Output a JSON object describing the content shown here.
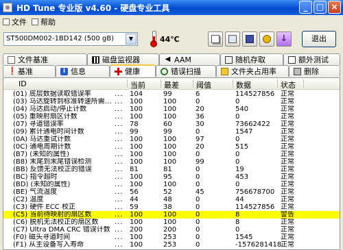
{
  "window": {
    "title": "HD Tune 专业版 v4.60 - 硬盘专业工具"
  },
  "menu": [
    {
      "label": "文件",
      "icon": "file-menu-icon"
    },
    {
      "label": "帮助",
      "icon": "help-menu-icon"
    }
  ],
  "toolbar": {
    "drive": "ST500DM002-1BD142 (500 gB)",
    "temperature": "44℃",
    "exit_label": "退出"
  },
  "tabs_top": [
    {
      "label": "文件基准",
      "icon": "file-benchmark-icon"
    },
    {
      "label": "磁盘监视器",
      "icon": "disk-monitor-icon"
    },
    {
      "label": "AAM",
      "icon": "speaker-icon"
    },
    {
      "label": "随机存取",
      "icon": "random-access-icon"
    },
    {
      "label": "额外测试",
      "icon": "extra-tests-icon"
    }
  ],
  "tabs_bottom": [
    {
      "label": "基准",
      "icon": "benchmark-icon"
    },
    {
      "label": "信息",
      "icon": "info-icon"
    },
    {
      "label": "健康",
      "icon": "health-cross-icon",
      "active": true
    },
    {
      "label": "错误扫描",
      "icon": "error-scan-icon"
    },
    {
      "label": "文件夹占用率",
      "icon": "folder-usage-icon"
    },
    {
      "label": "删除",
      "icon": "erase-icon"
    }
  ],
  "table": {
    "columns": [
      "ID",
      "当前",
      "最差",
      "阈值",
      "数据",
      "状态"
    ],
    "rows": [
      {
        "id": "(01) 底层数据读取错误率",
        "cur": "104",
        "worst": "99",
        "thr": "6",
        "data": "114527856",
        "status": "正常"
      },
      {
        "id": "(03) 马达旋转到标准转速所需…",
        "cur": "100",
        "worst": "100",
        "thr": "0",
        "data": "0",
        "status": "正常"
      },
      {
        "id": "(04) 马达启动/停止计数",
        "cur": "100",
        "worst": "100",
        "thr": "20",
        "data": "540",
        "status": "正常"
      },
      {
        "id": "(05) 重映射扇区计数",
        "cur": "100",
        "worst": "100",
        "thr": "36",
        "data": "0",
        "status": "正常"
      },
      {
        "id": "(07) 寻道错误率",
        "cur": "78",
        "worst": "60",
        "thr": "30",
        "data": "73662422",
        "status": "正常"
      },
      {
        "id": "(09) 累计通电时间计数",
        "cur": "99",
        "worst": "99",
        "thr": "0",
        "data": "1547",
        "status": "正常"
      },
      {
        "id": "(0A) 马达重试计数",
        "cur": "100",
        "worst": "100",
        "thr": "97",
        "data": "0",
        "status": "正常"
      },
      {
        "id": "(0C) 通电周期计数",
        "cur": "100",
        "worst": "100",
        "thr": "20",
        "data": "515",
        "status": "正常"
      },
      {
        "id": "(B7) (未知的属性)",
        "cur": "100",
        "worst": "100",
        "thr": "0",
        "data": "0",
        "status": "正常"
      },
      {
        "id": "(B8) 末尾到末尾错误检测",
        "cur": "100",
        "worst": "100",
        "thr": "99",
        "data": "0",
        "status": "正常"
      },
      {
        "id": "(BB) 反馈无法校正的错误",
        "cur": "81",
        "worst": "81",
        "thr": "0",
        "data": "19",
        "status": "正常"
      },
      {
        "id": "(BC) 指令超时",
        "cur": "100",
        "worst": "95",
        "thr": "0",
        "data": "453",
        "status": "正常"
      },
      {
        "id": "(BD) (未知的属性)",
        "cur": "100",
        "worst": "100",
        "thr": "0",
        "data": "0",
        "status": "正常"
      },
      {
        "id": "(BE) 气流温度",
        "cur": "56",
        "worst": "52",
        "thr": "45",
        "data": "756678700",
        "status": "正常"
      },
      {
        "id": "(C2) 温度",
        "cur": "44",
        "worst": "48",
        "thr": "0",
        "data": "44",
        "status": "正常"
      },
      {
        "id": "(C3) 硬件 ECC 校正",
        "cur": "59",
        "worst": "38",
        "thr": "0",
        "data": "114527856",
        "status": "正常"
      },
      {
        "id": "(C5) 当前待映射的扇区数",
        "cur": "100",
        "worst": "100",
        "thr": "0",
        "data": "8",
        "status": "警告",
        "warn": true
      },
      {
        "id": "(C6) 脱机无法校正的扇区数",
        "cur": "100",
        "worst": "100",
        "thr": "0",
        "data": "8",
        "status": "正常"
      },
      {
        "id": "(C7) Ultra DMA CRC 错误计数",
        "cur": "200",
        "worst": "200",
        "thr": "0",
        "data": "0",
        "status": "正常"
      },
      {
        "id": "(F0) 磁头寻道时间",
        "cur": "100",
        "worst": "253",
        "thr": "0",
        "data": "1545",
        "status": "正常"
      },
      {
        "id": "(F1) 从主设备写入寿命",
        "cur": "100",
        "worst": "253",
        "thr": "0",
        "data": "-1576281418",
        "status": "正常"
      }
    ]
  },
  "colors": {
    "title_bar": "#0a57d8",
    "warn_row": "#ffff00",
    "tab_highlight": "#ffc83c",
    "health_cross": "#d40000"
  }
}
